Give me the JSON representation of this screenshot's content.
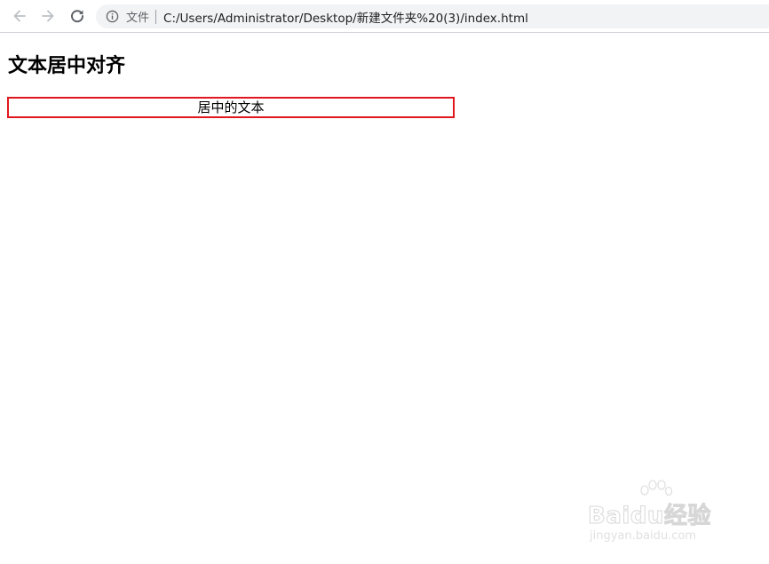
{
  "browser": {
    "scheme_label": "文件",
    "url": "C:/Users/Administrator/Desktop/新建文件夹%20(3)/index.html",
    "icons": {
      "back": "arrow-left-icon",
      "forward": "arrow-right-icon",
      "reload": "reload-icon",
      "info": "info-icon"
    }
  },
  "page": {
    "heading": "文本居中对齐",
    "box_text": "居中的文本",
    "box_border_color": "#e0181e"
  },
  "watermark": {
    "brand": "Baidu经验",
    "sub": "jingyan.baidu.com"
  }
}
